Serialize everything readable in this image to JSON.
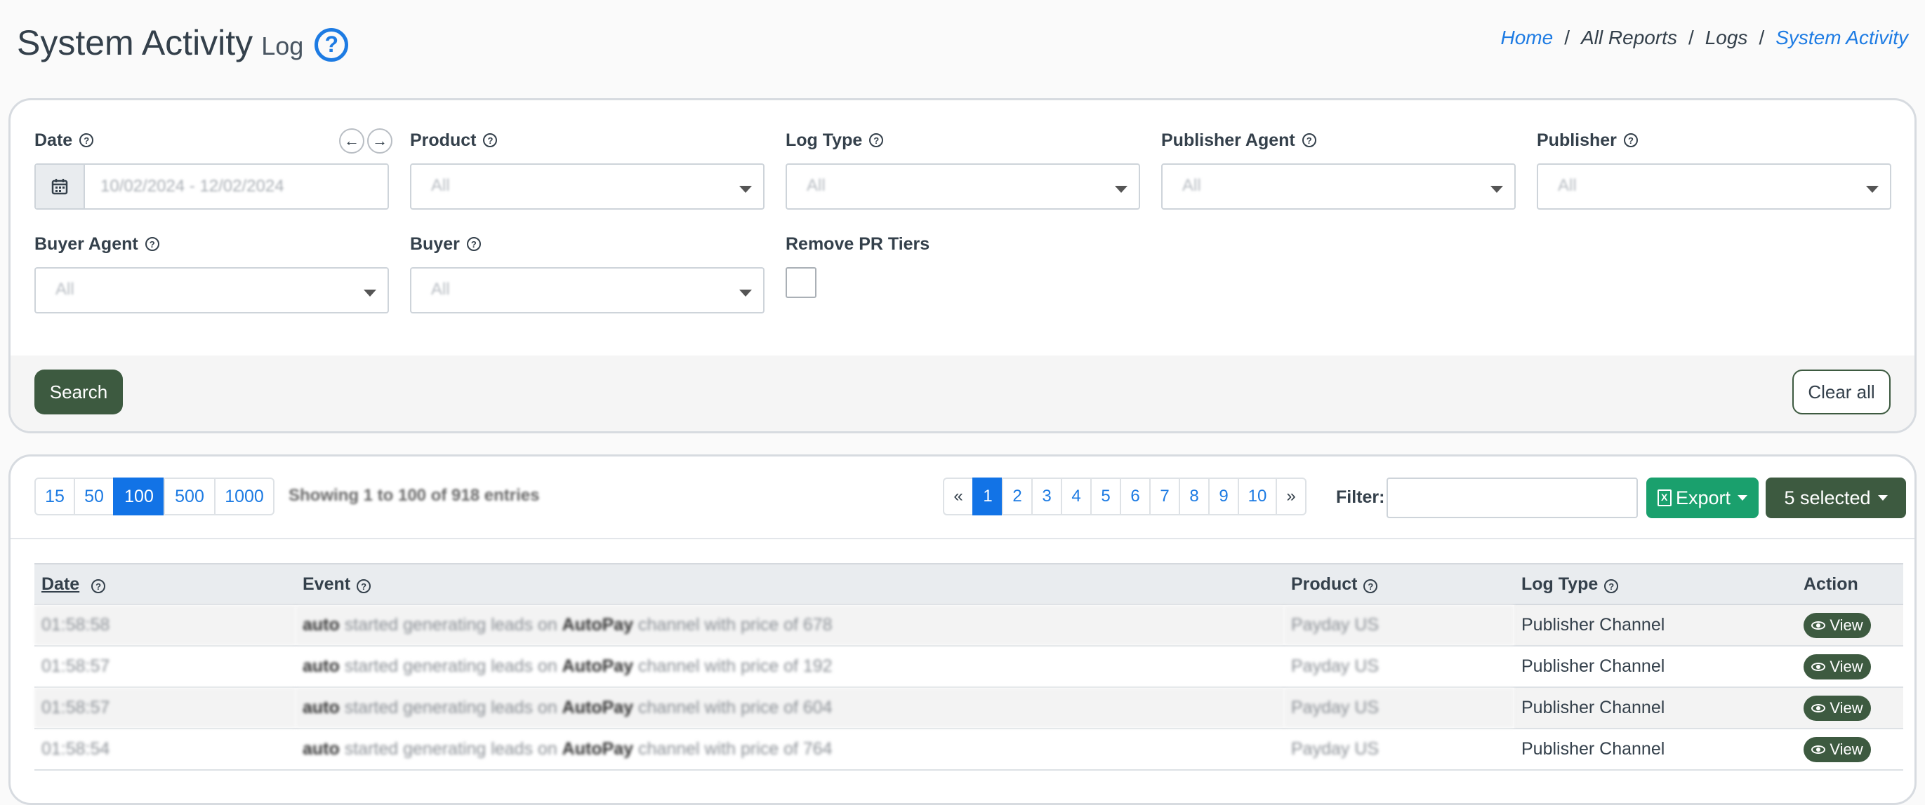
{
  "header": {
    "title": "System Activity",
    "subtitle": "Log",
    "help_icon": "?",
    "breadcrumb": [
      "Home",
      "All Reports",
      "Logs",
      "System Activity"
    ]
  },
  "filters": {
    "date": {
      "label": "Date",
      "value": "10/02/2024 - 12/02/2024"
    },
    "product": {
      "label": "Product",
      "value": "All"
    },
    "log_type": {
      "label": "Log Type",
      "value": "All"
    },
    "publisher_agent": {
      "label": "Publisher Agent",
      "value": "All"
    },
    "publisher": {
      "label": "Publisher",
      "value": "All"
    },
    "buyer_agent": {
      "label": "Buyer Agent",
      "value": "All"
    },
    "buyer": {
      "label": "Buyer",
      "value": "All"
    },
    "remove_pr_tiers": {
      "label": "Remove PR Tiers",
      "checked": false
    },
    "search_label": "Search",
    "clear_label": "Clear all"
  },
  "table_toolbar": {
    "page_lengths": [
      "15",
      "50",
      "100",
      "500",
      "1000"
    ],
    "active_length": "100",
    "info": "Showing 1 to 100 of 918 entries",
    "pages": [
      "«",
      "1",
      "2",
      "3",
      "4",
      "5",
      "6",
      "7",
      "8",
      "9",
      "10",
      "»"
    ],
    "active_page": "1",
    "filter_label": "Filter:",
    "filter_value": "",
    "export_label": "Export",
    "selected_label": "5 selected"
  },
  "table": {
    "columns": [
      "Date",
      "Event",
      "Product",
      "Log Type",
      "Action"
    ],
    "rows": [
      {
        "date": "01:58:58",
        "event_user": "auto",
        "event_mid": " started generating leads on ",
        "event_channel": "AutoPay",
        "event_tail": " channel with price of 678",
        "product": "Payday US",
        "log_type": "Publisher Channel",
        "action": "View"
      },
      {
        "date": "01:58:57",
        "event_user": "auto",
        "event_mid": " started generating leads on ",
        "event_channel": "AutoPay",
        "event_tail": " channel with price of 192",
        "product": "Payday US",
        "log_type": "Publisher Channel",
        "action": "View"
      },
      {
        "date": "01:58:57",
        "event_user": "auto",
        "event_mid": " started generating leads on ",
        "event_channel": "AutoPay",
        "event_tail": " channel with price of 604",
        "product": "Payday US",
        "log_type": "Publisher Channel",
        "action": "View"
      },
      {
        "date": "01:58:54",
        "event_user": "auto",
        "event_mid": " started generating leads on ",
        "event_channel": "AutoPay",
        "event_tail": " channel with price of 764",
        "product": "Payday US",
        "log_type": "Publisher Channel",
        "action": "View"
      }
    ]
  },
  "colors": {
    "primary_blue": "#1273e6",
    "dark_green": "#3d5a40",
    "export_green": "#1aa06d"
  }
}
